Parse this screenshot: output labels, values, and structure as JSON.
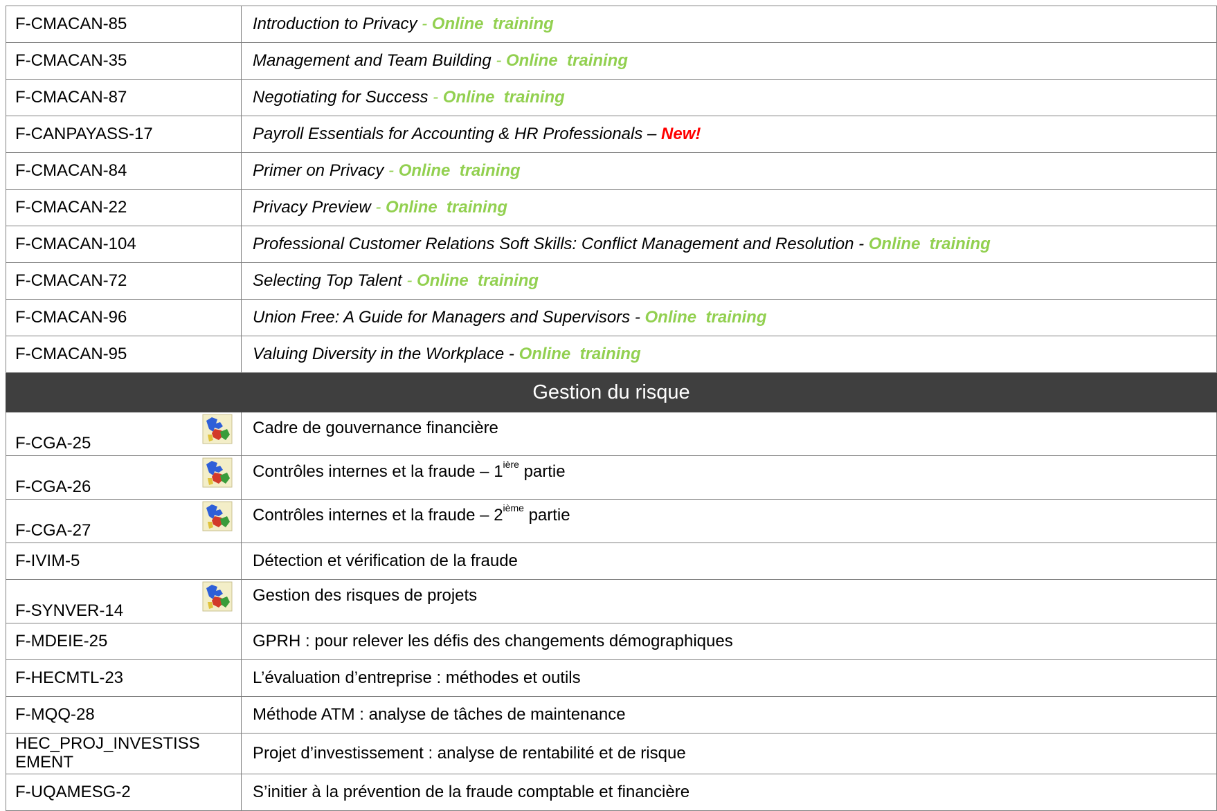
{
  "online_rows": [
    {
      "code": "F-CMACAN-85",
      "title": "Introduction to Privacy",
      "sep": " - ",
      "tag": "Online  training"
    },
    {
      "code": "F-CMACAN-35",
      "title": "Management and Team Building",
      "sep": " - ",
      "tag": "Online  training"
    },
    {
      "code": "F-CMACAN-87",
      "title": "Negotiating for Success",
      "sep": " - ",
      "tag": "Online  training"
    },
    {
      "code": "F-CANPAYASS-17",
      "title": "Payroll Essentials for Accounting & HR Professionals – ",
      "new": "New!"
    },
    {
      "code": "F-CMACAN-84",
      "title": "Primer on Privacy",
      "sep": " - ",
      "tag": "Online  training"
    },
    {
      "code": "F-CMACAN-22",
      "title": "Privacy Preview",
      "sep": " - ",
      "tag": "Online  training"
    },
    {
      "code": "F-CMACAN-104",
      "title": "Professional Customer Relations Soft Skills: Conflict Management and Resolution - ",
      "tag": "Online  training"
    },
    {
      "code": "F-CMACAN-72",
      "title": "Selecting Top Talent",
      "sep": " - ",
      "tag": "Online  training"
    },
    {
      "code": "F-CMACAN-96",
      "title": "Union Free: A Guide for Managers and Supervisors  - ",
      "tag": "Online  training"
    },
    {
      "code": "F-CMACAN-95",
      "title": "Valuing Diversity in the Workplace - ",
      "tag": "Online  training"
    }
  ],
  "section": {
    "title": "Gestion du risque"
  },
  "risk_rows": [
    {
      "code": "F-CGA-25",
      "title": "Cadre de gouvernance financière",
      "icon": "quebec-map-icon"
    },
    {
      "code": "F-CGA-26",
      "title_pre": "Contrôles internes et la fraude – 1",
      "sup": "ière",
      "title_post": " partie",
      "icon": "quebec-map-icon"
    },
    {
      "code": "F-CGA-27",
      "title_pre": "Contrôles internes et la fraude – 2",
      "sup": "ième",
      "title_post": " partie",
      "icon": "quebec-map-icon"
    },
    {
      "code": "F-IVIM-5",
      "title": "Détection et vérification de la fraude"
    },
    {
      "code": "F-SYNVER-14",
      "title": "Gestion des risques de projets",
      "icon": "quebec-map-icon"
    },
    {
      "code": "F-MDEIE-25",
      "title": "GPRH : pour relever les défis des changements démographiques"
    },
    {
      "code": "F-HECMTL-23",
      "title": "L’évaluation d’entreprise : méthodes et outils"
    },
    {
      "code": "F-MQQ-28",
      "title": "Méthode ATM : analyse de tâches de maintenance"
    },
    {
      "code_line1": "HEC_PROJ_INVESTISS",
      "code_line2": "EMENT",
      "title": "Projet d’investissement : analyse de rentabilité et de risque"
    },
    {
      "code": "F-UQAMESG-2",
      "title": "S’initier à la prévention de la fraude comptable et financière"
    }
  ],
  "colors": {
    "online": "#92d050",
    "new": "#ff0000",
    "header_bg": "#3f3f3f",
    "border": "#7f7f7f"
  }
}
